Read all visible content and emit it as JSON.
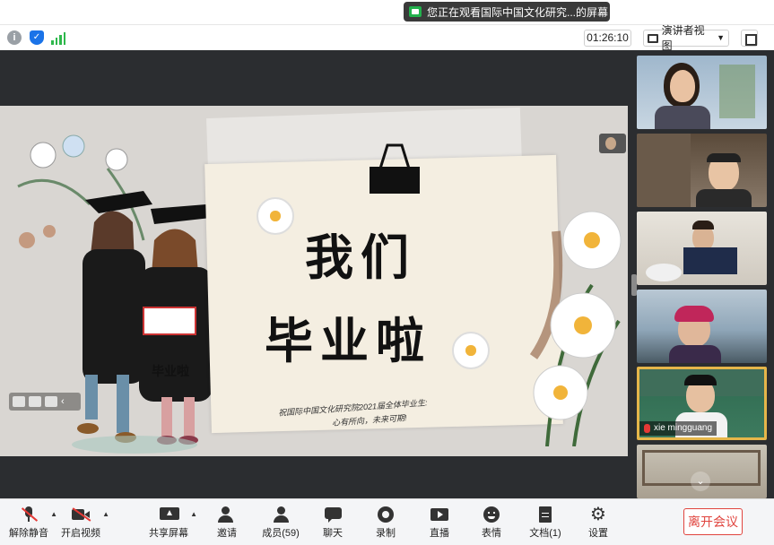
{
  "top": {
    "banner_text": "您正在观看国际中国文化研究...的屏幕"
  },
  "toolbar": {
    "timer": "01:26:10",
    "view_label": "演讲者视图"
  },
  "slide": {
    "title_line1": "我们",
    "title_line2": "毕业啦",
    "subtitle_line1": "祝国际中国文化研究院2021届全体毕业生:",
    "subtitle_line2": "心有所向，未来可期!",
    "sign_text": "毕业啦"
  },
  "participants": [
    {
      "id": "p1",
      "name": ""
    },
    {
      "id": "p2",
      "name": ""
    },
    {
      "id": "p3",
      "name": ""
    },
    {
      "id": "p4",
      "name": ""
    },
    {
      "id": "p5",
      "name": "xie mingguang",
      "muted": true,
      "active": true
    },
    {
      "id": "p6",
      "name": ""
    }
  ],
  "bottom": {
    "unmute": "解除静音",
    "start_video": "开启视频",
    "share_screen": "共享屏幕",
    "invite": "邀请",
    "members": "成员(59)",
    "chat": "聊天",
    "record": "录制",
    "live": "直播",
    "reactions": "表情",
    "docs": "文档(1)",
    "settings": "设置",
    "leave": "离开会议"
  },
  "colors": {
    "accent_red": "#e0443e",
    "active_speaker": "#e6b64a",
    "meeting_bg": "#2b2d30"
  }
}
